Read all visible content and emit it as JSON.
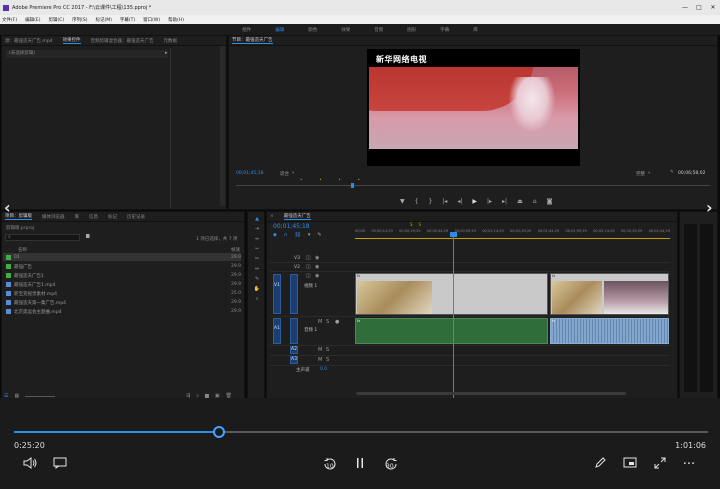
{
  "window": {
    "title": "Adobe Premiere Pro CC 2017 - F:\\云课件\\工程\\135.pproj *",
    "controls": [
      "—",
      "□",
      "✕"
    ]
  },
  "menu": [
    "文件(F)",
    "编辑(E)",
    "剪辑(C)",
    "序列(S)",
    "标记(M)",
    "字幕(T)",
    "窗口(W)",
    "帮助(H)"
  ],
  "workspaces": {
    "items": [
      "组件",
      "编辑",
      "颜色",
      "效果",
      "音频",
      "图形",
      "字幕",
      "库"
    ],
    "active_index": 1
  },
  "source_panel": {
    "tabs": [
      "源：最强造天广告.mp4",
      "效果控件",
      "音频剪辑混合器：最强造天广告",
      "元数据"
    ],
    "active_tab": 1,
    "note": "(未选择剪辑)"
  },
  "program_monitor": {
    "title": "节目：最强造天广告",
    "logo_text": "新华网络电视",
    "timecode": "00;01;45;18",
    "zoom": "适合",
    "quality": "完整",
    "duration": "00;06;58;02"
  },
  "project_panel": {
    "tabs": [
      "项目：剪辑版",
      "媒体浏览器",
      "库",
      "信息",
      "标记",
      "历史记录"
    ],
    "active_tab": 0,
    "project_name": "剪辑版.prproj",
    "selection_info": "1 项已选择，共 7 项",
    "col_name": "名称",
    "col_rate": "帧速",
    "items": [
      {
        "name": "01",
        "rate": "29.9",
        "color": "#3fae4a"
      },
      {
        "name": "最强广告",
        "rate": "29.9",
        "color": "#3fae4a"
      },
      {
        "name": "最强造天广告1",
        "rate": "29.9",
        "color": "#3fae4a"
      },
      {
        "name": "最强造天广告1.mp4",
        "rate": "29.9",
        "color": "#5b8ad6"
      },
      {
        "name": "新宝克视觉素材.mp4",
        "rate": "25.0",
        "color": "#5b8ad6"
      },
      {
        "name": "最强造天第一集广告.mp4",
        "rate": "29.9",
        "color": "#5b8ad6"
      },
      {
        "name": "北京奥运会主题曲.mp4",
        "rate": "29.9",
        "color": "#5b8ad6"
      }
    ]
  },
  "timeline": {
    "tab": "最强造天广告",
    "timecode": "00;01;45;18",
    "ruler": [
      "00;00",
      "00;00;14;29",
      "00;00;29;29",
      "00;00;44;29",
      "00;00;59;29",
      "00;01;14;29",
      "00;01;29;29",
      "00;01;44;29",
      "00;01;59;29",
      "00;02;14;29",
      "00;02;29;29",
      "00;02;44;29",
      "00;02;59;29",
      "00;03;14;29",
      "00;03;29;29",
      "00;03;44;29"
    ],
    "tracks": [
      "V3",
      "V2",
      "V1",
      "A1",
      "A2",
      "A3"
    ],
    "v1_label": "视频 1",
    "a1_label": "音频 1",
    "master_label": "主声道",
    "master_value": "0.0",
    "clip_fx_label": "fx",
    "marks": [
      "S",
      "S"
    ]
  },
  "player": {
    "elapsed": "0:25:20",
    "total": "1:01:06",
    "progress": 0.295,
    "skip_back": "10",
    "skip_fwd": "30"
  }
}
